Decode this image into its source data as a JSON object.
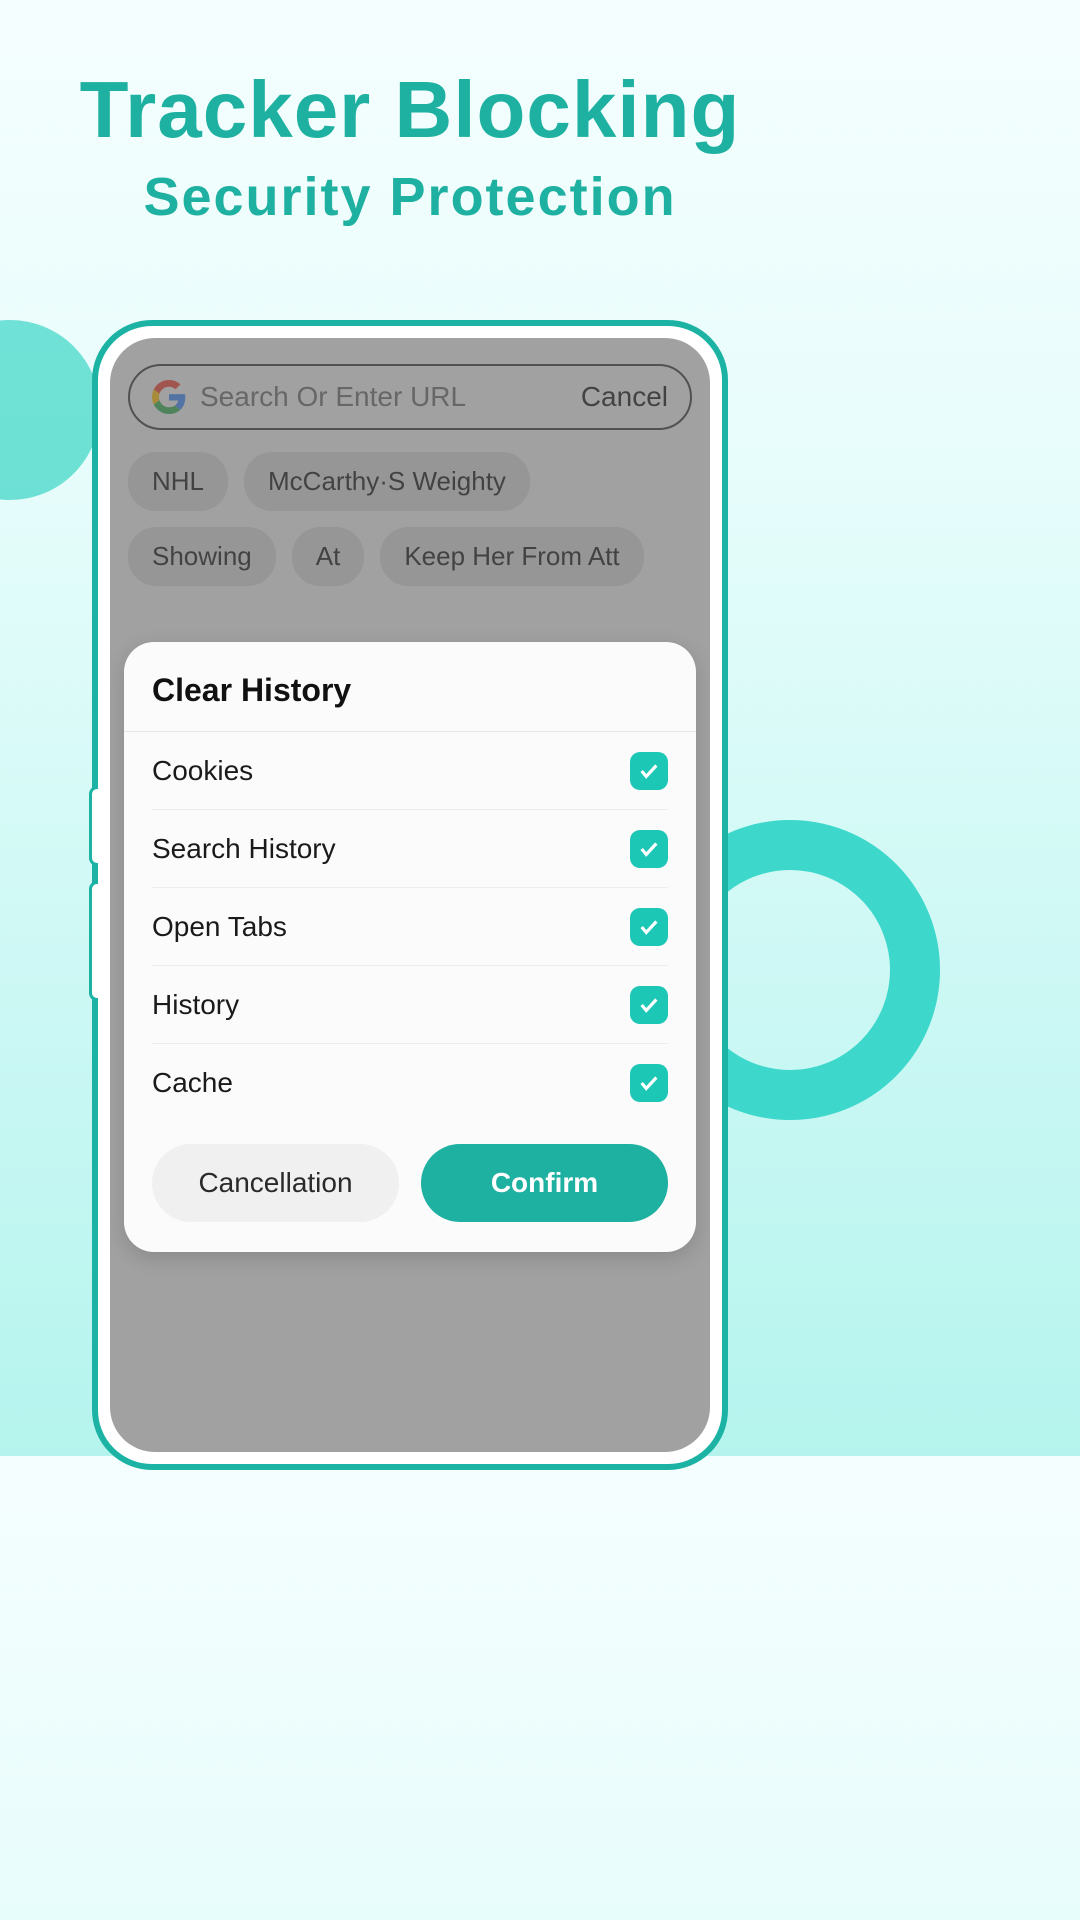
{
  "headline": {
    "title": "Tracker  Blocking",
    "subtitle": "Security  Protection"
  },
  "search": {
    "placeholder": "Search Or Enter URL",
    "cancel": "Cancel"
  },
  "chips": [
    "NHL",
    "McCarthy·S Weighty",
    "Showing",
    "At",
    "Keep Her From Att"
  ],
  "modal": {
    "title": "Clear History",
    "options": [
      {
        "label": "Cookies",
        "checked": true
      },
      {
        "label": "Search History",
        "checked": true
      },
      {
        "label": "Open Tabs",
        "checked": true
      },
      {
        "label": "History",
        "checked": true
      },
      {
        "label": "Cache",
        "checked": true
      }
    ],
    "cancel": "Cancellation",
    "confirm": "Confirm"
  }
}
